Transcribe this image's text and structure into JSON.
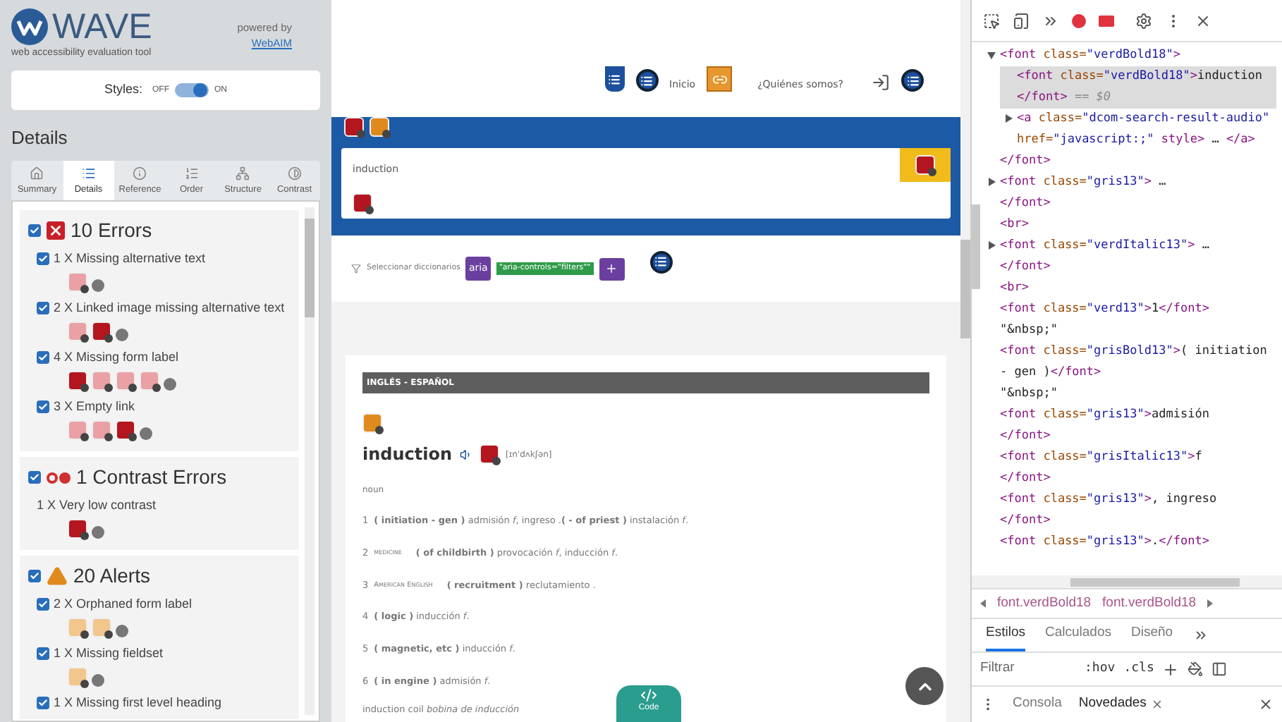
{
  "wave": {
    "logo": "WAVE",
    "tagline": "web accessibility evaluation tool",
    "powered_by": "powered by",
    "link": "WebAIM",
    "styles": {
      "label": "Styles:",
      "off": "OFF",
      "on_label": "ON",
      "on": true
    },
    "heading": "Details",
    "tabs": [
      {
        "label": "Summary",
        "kind": "summary",
        "selected": false
      },
      {
        "label": "Details",
        "kind": "details",
        "selected": true
      },
      {
        "label": "Reference",
        "kind": "reference",
        "selected": false
      },
      {
        "label": "Order",
        "kind": "order",
        "selected": false
      },
      {
        "label": "Structure",
        "kind": "structure",
        "selected": false
      },
      {
        "label": "Contrast",
        "kind": "contrast",
        "selected": false
      }
    ],
    "groups": [
      {
        "kind": "errors",
        "checked": true,
        "title": "10 Errors",
        "items": [
          {
            "kind": "checkbox",
            "checked": true,
            "label": "1 X Missing alternative text",
            "icons": [
              {
                "selected": false
              }
            ]
          },
          {
            "kind": "checkbox",
            "checked": true,
            "label": "2 X Linked image missing alternative text",
            "icons": [
              {
                "selected": false
              },
              {
                "selected": true
              }
            ]
          },
          {
            "kind": "checkbox",
            "checked": true,
            "label": "4 X Missing form label",
            "icons": [
              {
                "selected": true
              },
              {
                "selected": false
              },
              {
                "selected": false
              },
              {
                "selected": false
              }
            ]
          },
          {
            "kind": "checkbox",
            "checked": true,
            "label": "3 X Empty link",
            "icons": [
              {
                "selected": false
              },
              {
                "selected": false
              },
              {
                "selected": true
              }
            ]
          }
        ]
      },
      {
        "kind": "contrast",
        "checked": true,
        "title": "1 Contrast Errors",
        "items": [
          {
            "kind": "plain",
            "label": "1 X Very low contrast",
            "icons": [
              {
                "selected": true
              }
            ]
          }
        ]
      },
      {
        "kind": "alerts",
        "checked": true,
        "title": "20 Alerts",
        "items": [
          {
            "kind": "checkbox",
            "checked": true,
            "label": "2 X Orphaned form label",
            "icons": [
              {
                "selected": false
              },
              {
                "selected": false
              }
            ]
          },
          {
            "kind": "checkbox",
            "checked": true,
            "label": "1 X Missing fieldset",
            "icons": [
              {
                "selected": false
              }
            ]
          },
          {
            "kind": "checkbox",
            "checked": true,
            "label": "1 X Missing first level heading"
          }
        ]
      }
    ]
  },
  "page": {
    "nav": [
      {
        "label": "Inicio"
      },
      {
        "label": "¿Quiénes somos?"
      }
    ],
    "search": {
      "value": "induction"
    },
    "filter": {
      "label": "Seleccionar diccionarios",
      "aria_tag": "aria",
      "aria_code": "\"aria-controls=\"filters\"\""
    },
    "dictionary": {
      "header": "INGLÉS - ESPAÑOL",
      "word": "induction",
      "pronunciation": "[ɪnˈdʌkʃən]",
      "part_of_speech": "noun",
      "senses": [
        {
          "number": "1",
          "text": "**( initiation - gen )** admisión *f*, ingreso .**( - of priest )** instalación *f*."
        },
        {
          "number": "2",
          "register": "medicine",
          "text": "**( of childbirth )** provocación *f*, inducción *f*."
        },
        {
          "number": "3",
          "register": "American English",
          "text": "**( recruitment )** reclutamiento ."
        },
        {
          "number": "4",
          "text": "**( logic )** inducción *f*."
        },
        {
          "number": "5",
          "text": "**( magnetic, etc )** inducción *f*."
        },
        {
          "number": "6",
          "text": "**( in engine )** admisión *f*."
        }
      ],
      "compound": "induction coil *bobina de inducción*"
    },
    "code_button": "Code"
  },
  "devtools": {
    "nodes": [
      {
        "markup": "<font class=\"verdBold18\">",
        "kind": "open",
        "selected": false,
        "children": [
          {
            "markup": "<font class=\"verdBold18\">induction </font>",
            "ref": "== $0",
            "kind": "leaf",
            "selected": true
          },
          {
            "markup": "<a class=\"dcom-search-result-audio\" href=\"javascript:;\" style> … </a>",
            "kind": "closed",
            "selected": false
          }
        ],
        "close": "</font>"
      },
      {
        "markup": "<font class=\"gris13\"> … ",
        "kind": "closed",
        "selected": false,
        "close": "</font>"
      },
      {
        "markup": "<br>",
        "kind": "leaf",
        "selected": false
      },
      {
        "markup": "<font class=\"verdItalic13\"> … ",
        "kind": "closed",
        "selected": false,
        "close": "</font>"
      },
      {
        "markup": "<br>",
        "kind": "leaf",
        "selected": false
      },
      {
        "markup": "<font class=\"verd13\">1</font>",
        "kind": "leaf",
        "selected": false
      },
      {
        "markup": "\"&nbsp;\"",
        "kind": "leaf",
        "selected": false
      },
      {
        "markup": "<font class=\"grisBold13\">( initiation - gen )</font>",
        "kind": "leaf",
        "selected": false
      },
      {
        "markup": "\"&nbsp;\"",
        "kind": "leaf",
        "selected": false
      },
      {
        "markup": "<font class=\"gris13\">admisión ",
        "kind": "leaf",
        "selected": false,
        "close": "</font>"
      },
      {
        "markup": "<font class=\"grisItalic13\">f ",
        "kind": "leaf",
        "selected": false,
        "close": "</font>"
      },
      {
        "markup": "<font class=\"gris13\">, ingreso ",
        "kind": "leaf",
        "selected": false,
        "close": "</font>"
      },
      {
        "markup": "<font class=\"gris13\">.</font>",
        "kind": "leaf",
        "selected": false
      }
    ],
    "breadcrumbs": [
      "font.verdBold18",
      "font.verdBold18"
    ],
    "tabs": [
      {
        "label": "Estilos",
        "selected": true
      },
      {
        "label": "Calculados",
        "selected": false
      },
      {
        "label": "Diseño",
        "selected": false
      }
    ],
    "filter": {
      "placeholder": "Filtrar"
    },
    "filter_buttons": [
      ":hov",
      ".cls"
    ],
    "drawer_tabs": [
      {
        "label": "Consola",
        "selected": false,
        "closable": false
      },
      {
        "label": "Novedades",
        "selected": true,
        "closable": true
      }
    ]
  }
}
